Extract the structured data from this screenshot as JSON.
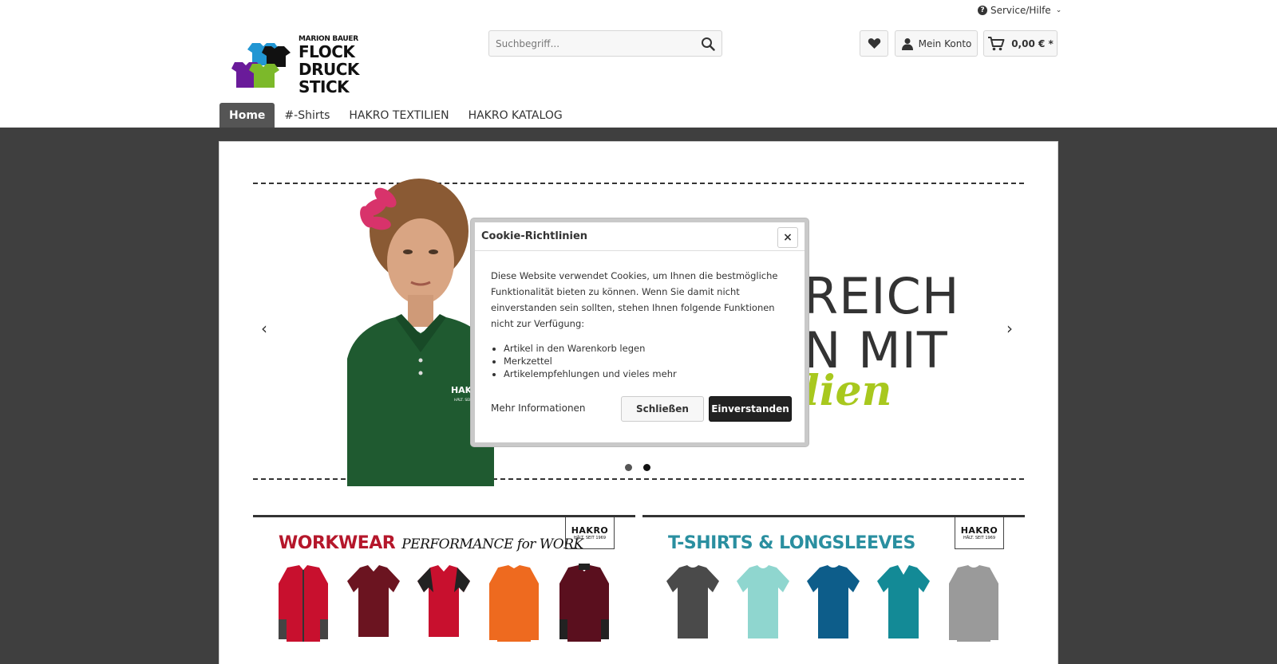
{
  "header": {
    "service_label": "Service/Hilfe",
    "logo": {
      "small": "MARION BAUER",
      "line1": "FLOCK",
      "line2": "DRUCK",
      "line3": "STICK"
    },
    "search": {
      "placeholder": "Suchbegriff..."
    },
    "account_label": "Mein Konto",
    "cart_total": "0,00 € *"
  },
  "nav": {
    "items": [
      {
        "label": "Home",
        "active": true
      },
      {
        "label": "#-Shirts"
      },
      {
        "label": "HAKRO TEXTILIEN"
      },
      {
        "label": "HAKRO KATALOG"
      }
    ]
  },
  "slider": {
    "text_line1": "REICH",
    "text_line2": "N MIT",
    "script_text": "lien",
    "shirt_brand": "HAKRO",
    "shirt_tagline": "HÄLT. SEIT 1969",
    "dots": 2,
    "active_dot": 1
  },
  "banners": [
    {
      "title": "WORKWEAR",
      "subtitle": "PERFORMANCE for WORK",
      "title_color": "#b5172b",
      "badge": "HAKRO",
      "badge_sub": "HÄLT. SEIT 1969"
    },
    {
      "title": "T-SHIRTS & LONGSLEEVES",
      "subtitle": "",
      "title_color": "#2a8fa0",
      "badge": "HAKRO",
      "badge_sub": "HÄLT. SEIT 1969"
    }
  ],
  "cookie_modal": {
    "title": "Cookie-Richtlinien",
    "close_symbol": "×",
    "body": "Diese Website verwendet Cookies, um Ihnen die bestmögliche Funktionalität bieten zu können. Wenn Sie damit nicht einverstanden sein sollten, stehen Ihnen folgende Funktionen nicht zur Verfügung:",
    "list": [
      "Artikel in den Warenkorb legen",
      "Merkzettel",
      "Artikelempfehlungen und vieles mehr"
    ],
    "more_link": "Mehr Informationen",
    "close_button": "Schließen",
    "accept_button": "Einverstanden"
  },
  "colors": {
    "page_background": "#3f3f3f",
    "nav_active": "#555555",
    "accent_green": "#a8c81e",
    "workwear_red": "#b5172b",
    "tshirt_teal": "#2a8fa0"
  }
}
